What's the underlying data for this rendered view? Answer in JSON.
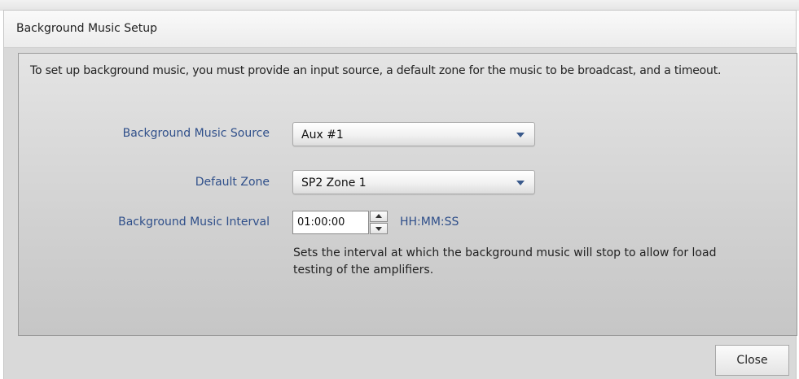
{
  "dialog": {
    "title": "Background Music Setup",
    "intro_text": "To set up background music, you must provide an input source, a default zone for the music to be broadcast, and a timeout."
  },
  "form": {
    "source": {
      "label": "Background Music Source",
      "selected": "Aux #1"
    },
    "zone": {
      "label": "Default Zone",
      "selected": "SP2 Zone 1"
    },
    "interval": {
      "label": "Background Music Interval",
      "value": "01:00:00",
      "format_hint": "HH:MM:SS",
      "help_text": "Sets the interval at which the background music will stop to allow for load testing of the amplifiers."
    }
  },
  "footer": {
    "close_label": "Close"
  },
  "colors": {
    "label_blue": "#2f4f8a",
    "panel_gray": "#d1d1d1",
    "arrow_blue": "#3a5a8c"
  },
  "icons": {
    "dropdown_arrow": "chevron-down-icon",
    "spin_up": "arrow-up-icon",
    "spin_down": "arrow-down-icon"
  }
}
